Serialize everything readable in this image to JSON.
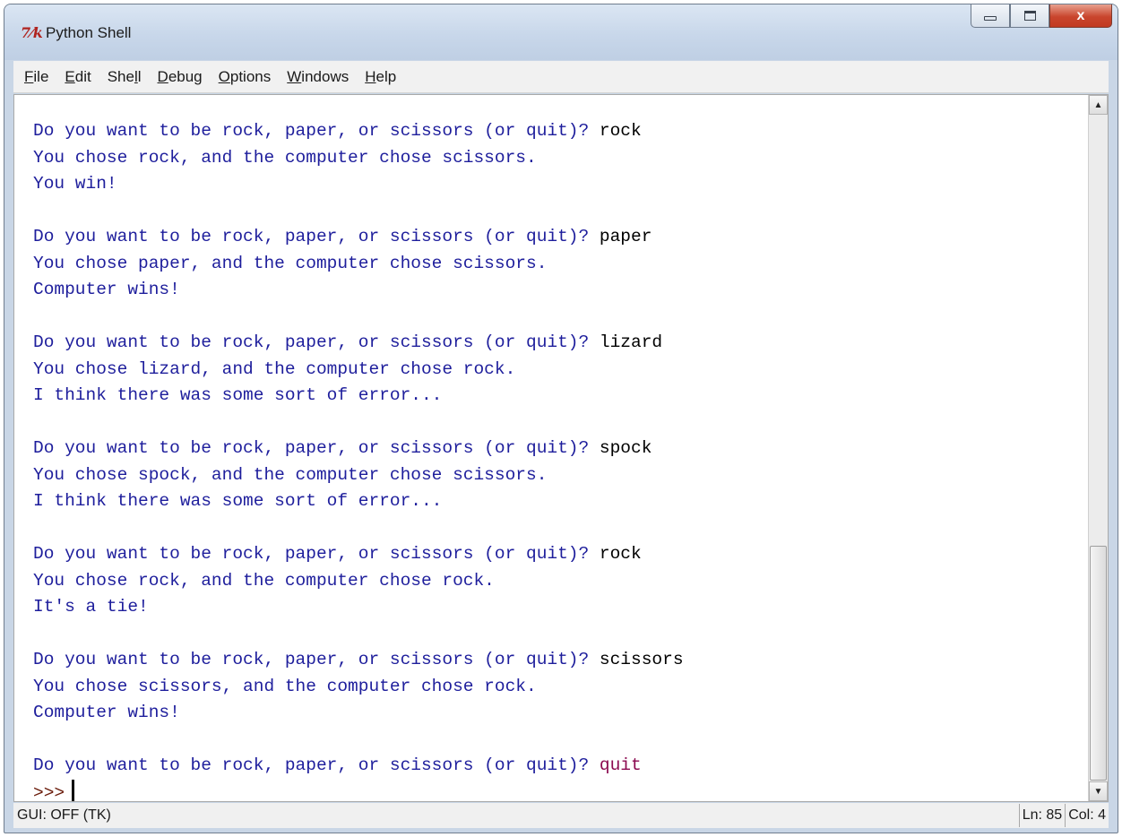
{
  "window": {
    "title": "Python Shell",
    "icon": "tk-feather-icon",
    "controls": {
      "minimize": "minimize-icon",
      "maximize": "maximize-icon",
      "close": "x"
    }
  },
  "menu": [
    "File",
    "Edit",
    "Shell",
    "Debug",
    "Options",
    "Windows",
    "Help"
  ],
  "menu_mnemonics": [
    "F",
    "E",
    "l",
    "D",
    "O",
    "W",
    "H"
  ],
  "shell": {
    "rounds": [
      {
        "prompt": "Do you want to be rock, paper, or scissors (or quit)? ",
        "input": "rock",
        "chose": "You chose rock, and the computer chose scissors.",
        "result": "You win!"
      },
      {
        "prompt": "Do you want to be rock, paper, or scissors (or quit)? ",
        "input": "paper",
        "chose": "You chose paper, and the computer chose scissors.",
        "result": "Computer wins!"
      },
      {
        "prompt": "Do you want to be rock, paper, or scissors (or quit)? ",
        "input": "lizard",
        "chose": "You chose lizard, and the computer chose rock.",
        "result": "I think there was some sort of error..."
      },
      {
        "prompt": "Do you want to be rock, paper, or scissors (or quit)? ",
        "input": "spock",
        "chose": "You chose spock, and the computer chose scissors.",
        "result": "I think there was some sort of error..."
      },
      {
        "prompt": "Do you want to be rock, paper, or scissors (or quit)? ",
        "input": "rock",
        "chose": "You chose rock, and the computer chose rock.",
        "result": "It's a tie!"
      },
      {
        "prompt": "Do you want to be rock, paper, or scissors (or quit)? ",
        "input": "scissors",
        "chose": "You chose scissors, and the computer chose rock.",
        "result": "Computer wins!"
      }
    ],
    "final_prompt": "Do you want to be rock, paper, or scissors (or quit)? ",
    "final_input": "quit",
    "repl_prompt": ">>>"
  },
  "status": {
    "left": "GUI: OFF (TK)",
    "line": "Ln: 85",
    "col": "Col: 4"
  },
  "colors": {
    "output": "#1e1e9c",
    "input": "#000000",
    "last_input": "#8b0a50",
    "close_button": "#c9452d"
  }
}
